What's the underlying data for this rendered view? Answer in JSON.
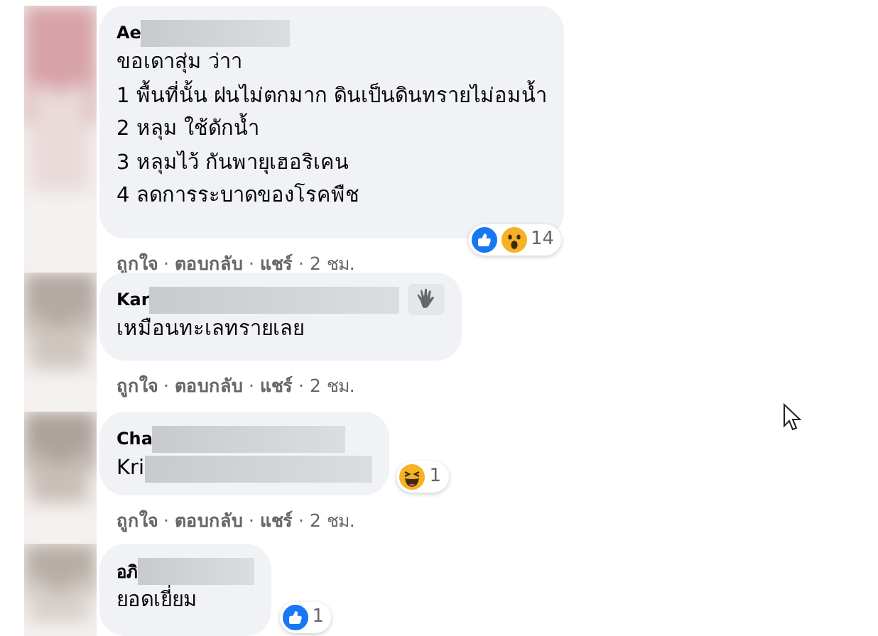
{
  "comments": [
    {
      "name": "Ae",
      "name_redacted": true,
      "lines": [
        "ขอเดาสุ่ม ว่าา",
        "1 พื้นที่นั้น ฝนไม่ตกมาก ดินเป็นดินทรายไม่อมน้ำ",
        "2 หลุม ใช้ดักน้ำ",
        "3 หลุมไว้ กันพายุเฮอริเคน",
        "4 ลดการระบาดของโรคพืช"
      ],
      "reactions": {
        "kinds": [
          {
            "kind": "like"
          },
          {
            "kind": "wow"
          }
        ],
        "count": "14"
      },
      "actions": [
        {
          "kind": "link",
          "label": "ถูกใจ"
        },
        {
          "kind": "dot",
          "label": "·"
        },
        {
          "kind": "link",
          "label": "ตอบกลับ"
        },
        {
          "kind": "dot",
          "label": "·"
        },
        {
          "kind": "link",
          "label": "แชร์"
        },
        {
          "kind": "dot",
          "label": "·"
        },
        {
          "kind": "time",
          "label": "2 ชม."
        }
      ]
    },
    {
      "name": "Kar",
      "name_redacted": true,
      "lines": [
        "เหมือนทะเลทรายเลย"
      ],
      "badge": {
        "kind": "wave"
      },
      "actions": [
        {
          "kind": "link",
          "label": "ถูกใจ"
        },
        {
          "kind": "dot",
          "label": "·"
        },
        {
          "kind": "link",
          "label": "ตอบกลับ"
        },
        {
          "kind": "dot",
          "label": "·"
        },
        {
          "kind": "link",
          "label": "แชร์"
        },
        {
          "kind": "dot",
          "label": "·"
        },
        {
          "kind": "time",
          "label": "2 ชม."
        }
      ]
    },
    {
      "name": "Cha",
      "name_redacted": true,
      "lines": [
        "Kri"
      ],
      "text_redacted": true,
      "reactions": {
        "kinds": [
          {
            "kind": "haha"
          }
        ],
        "count": "1"
      },
      "actions": [
        {
          "kind": "link",
          "label": "ถูกใจ"
        },
        {
          "kind": "dot",
          "label": "·"
        },
        {
          "kind": "link",
          "label": "ตอบกลับ"
        },
        {
          "kind": "dot",
          "label": "·"
        },
        {
          "kind": "link",
          "label": "แชร์"
        },
        {
          "kind": "dot",
          "label": "·"
        },
        {
          "kind": "time",
          "label": "2 ชม."
        }
      ]
    },
    {
      "name": "อภิ",
      "name_redacted": true,
      "lines": [
        "ยอดเยี่ยม"
      ],
      "reactions": {
        "kinds": [
          {
            "kind": "like"
          }
        ],
        "count": "1"
      }
    }
  ]
}
